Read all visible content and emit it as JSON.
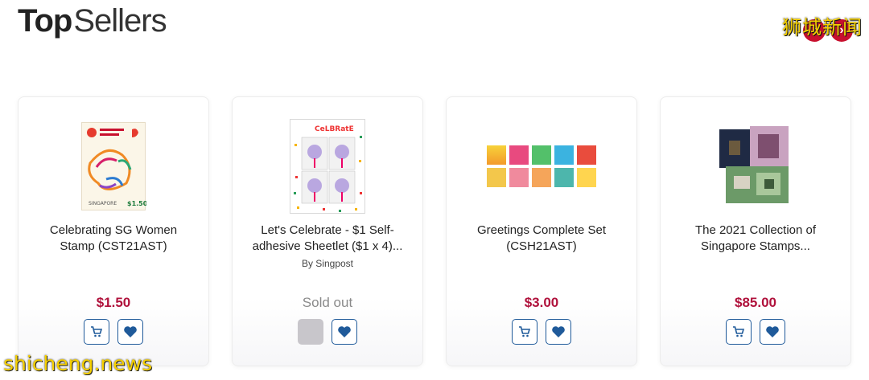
{
  "header": {
    "title_strong": "Top",
    "title_light": "Sellers"
  },
  "nav": {
    "prev_icon": "chevron-left-icon",
    "next_icon": "chevron-right-icon"
  },
  "watermarks": {
    "cn": "狮城新闻",
    "en": "shicheng.news"
  },
  "products": [
    {
      "name": "Celebrating SG Women Stamp (CST21AST)",
      "vendor": "",
      "price": "$1.50",
      "status": "",
      "stamp_value": "$1.50"
    },
    {
      "name": "Let's Celebrate - $1 Self-adhesive Sheetlet ($1 x 4)...",
      "vendor": "By Singpost",
      "price": "",
      "status": "Sold out"
    },
    {
      "name": "Greetings Complete Set (CSH21AST)",
      "vendor": "",
      "price": "$3.00",
      "status": ""
    },
    {
      "name": "The 2021 Collection of Singapore Stamps...",
      "vendor": "",
      "price": "$85.00",
      "status": ""
    }
  ],
  "colors": {
    "price": "#b0123c",
    "action_border": "#1f5a9a",
    "nav": "#c8102e",
    "watermark": "#f6d000"
  }
}
